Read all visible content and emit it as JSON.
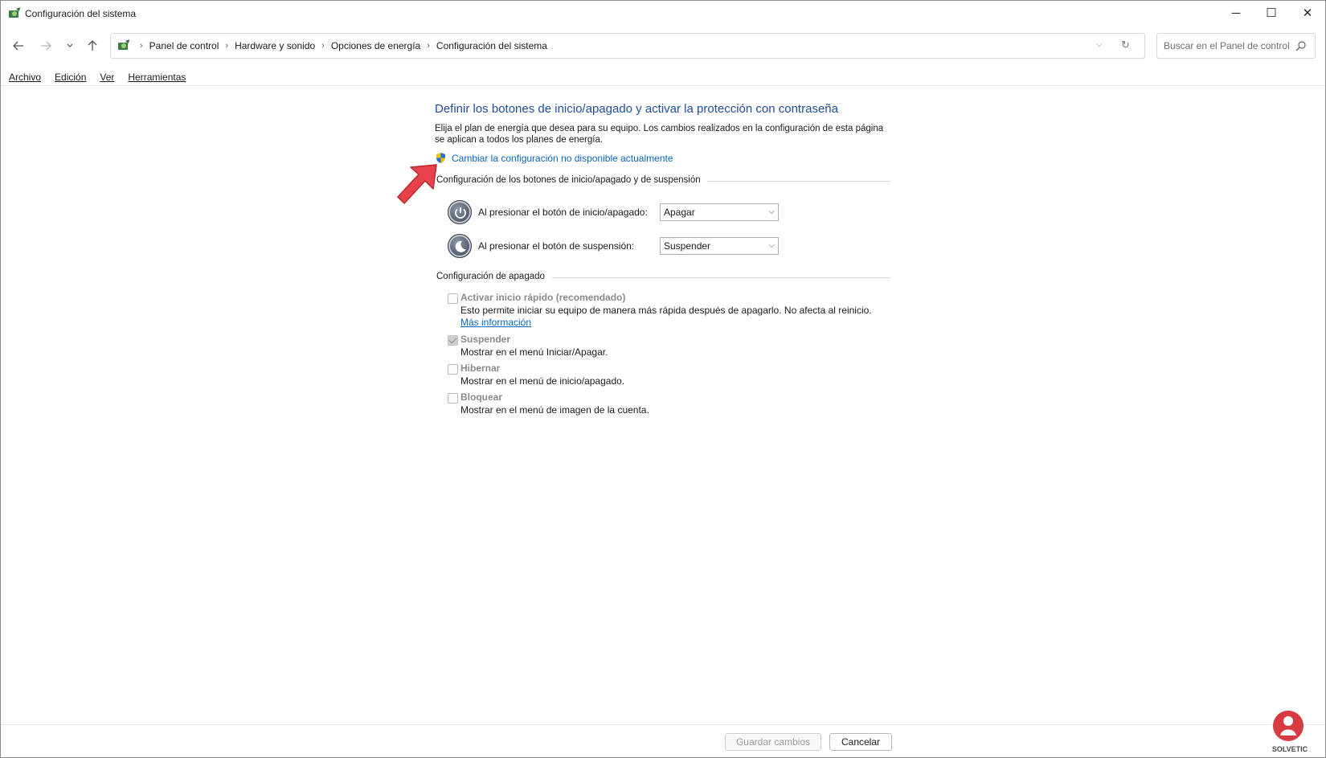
{
  "window": {
    "title": "Configuración del sistema",
    "controls": {
      "minimize": "─",
      "maximize": "☐",
      "close": "✕"
    }
  },
  "nav": {
    "back_icon": "arrow-left",
    "forward_icon": "arrow-right",
    "recent_icon": "chevron-down",
    "up_icon": "arrow-up",
    "breadcrumbs": [
      "Panel de control",
      "Hardware y sonido",
      "Opciones de energía",
      "Configuración del sistema"
    ],
    "search_placeholder": "Buscar en el Panel de control"
  },
  "menubar": {
    "items": [
      "Archivo",
      "Edición",
      "Ver",
      "Herramientas"
    ]
  },
  "main": {
    "heading": "Definir los botones de inicio/apagado y activar la protección con contraseña",
    "description": "Elija el plan de energía que desea para su equipo. Los cambios realizados en la configuración de esta página se aplican a todos los planes de energía.",
    "change_link": "Cambiar la configuración no disponible actualmente",
    "power_group": {
      "title": "Configuración de los botones de inicio/apagado y de suspensión",
      "rows": [
        {
          "label": "Al presionar el botón de inicio/apagado:",
          "value": "Apagar",
          "icon": "power-icon"
        },
        {
          "label": "Al presionar el botón de suspensión:",
          "value": "Suspender",
          "icon": "sleep-icon"
        }
      ]
    },
    "shutdown_group": {
      "title": "Configuración de apagado",
      "options": [
        {
          "title": "Activar inicio rápido (recomendado)",
          "desc": "Esto permite iniciar su equipo de manera más rápida después de apagarlo. No afecta al reinicio.",
          "link": "Más información",
          "checked": false
        },
        {
          "title": "Suspender",
          "desc": "Mostrar en el menú Iniciar/Apagar.",
          "checked": true
        },
        {
          "title": "Hibernar",
          "desc": "Mostrar en el menú de inicio/apagado.",
          "checked": false
        },
        {
          "title": "Bloquear",
          "desc": "Mostrar en el menú de imagen de la cuenta.",
          "checked": false
        }
      ]
    }
  },
  "footer": {
    "save_label": "Guardar cambios",
    "cancel_label": "Cancelar"
  },
  "colors": {
    "heading": "#1e4e9c",
    "link": "#0b66c3",
    "annotation_arrow": "#e8434a"
  }
}
